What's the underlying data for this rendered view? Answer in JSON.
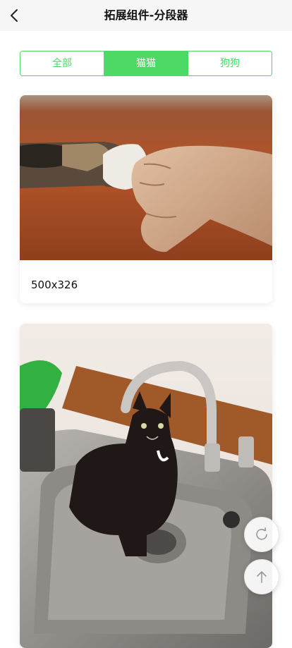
{
  "nav": {
    "title": "拓展组件-分段器",
    "back_icon": "chevron-left-icon"
  },
  "segments": [
    {
      "label": "全部",
      "active": false
    },
    {
      "label": "猫猫",
      "active": true
    },
    {
      "label": "狗狗",
      "active": false
    }
  ],
  "cards": [
    {
      "caption": "500x326",
      "image": "cat-paw-fist-bump-photo"
    },
    {
      "image": "black-kitten-in-sink-photo"
    }
  ],
  "floating": {
    "refresh_icon": "refresh-icon",
    "top_icon": "arrow-up-icon"
  },
  "colors": {
    "accent": "#4cd964",
    "navbar_bg": "#f6f6f6"
  }
}
